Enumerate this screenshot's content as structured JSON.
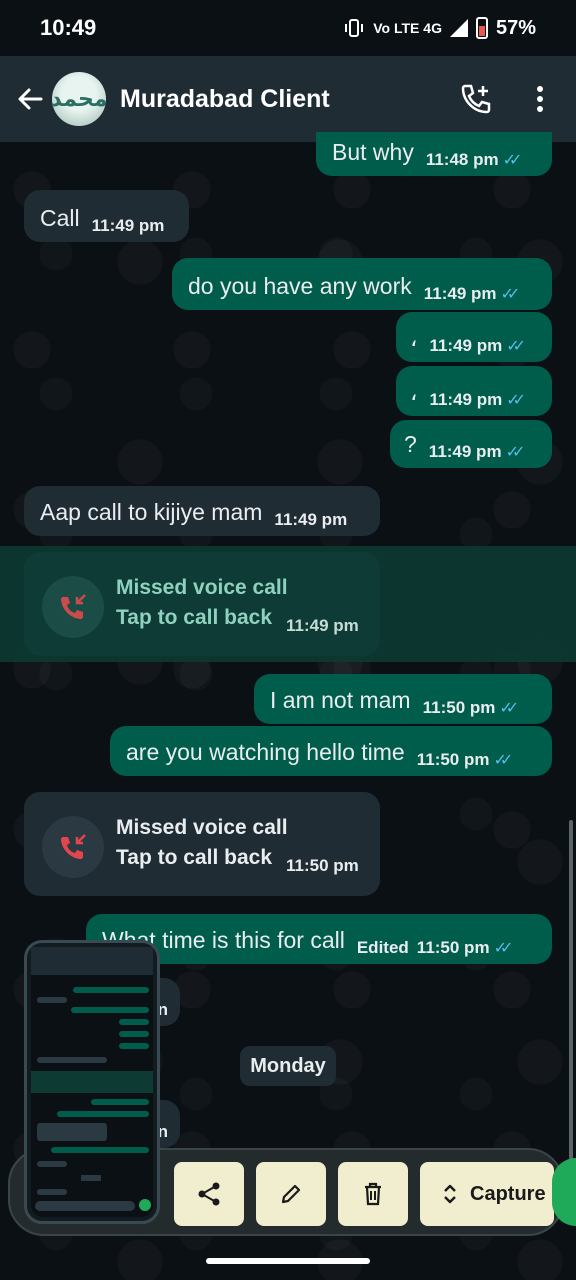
{
  "status_bar": {
    "time": "10:49",
    "network": "Vo LTE 4G",
    "battery": "57%"
  },
  "header": {
    "avatar_text": "محمد",
    "contact_name": "Muradabad Client"
  },
  "messages": [
    {
      "dir": "out",
      "text": "But why",
      "time": "11:48 pm",
      "ticks": "✓✓"
    },
    {
      "dir": "in",
      "text": "Call",
      "time": "11:49 pm"
    },
    {
      "dir": "out",
      "text": "do you have any work",
      "time": "11:49 pm",
      "ticks": "✓✓"
    },
    {
      "dir": "out",
      "text": "،",
      "time": "11:49 pm",
      "ticks": "✓✓"
    },
    {
      "dir": "out",
      "text": "،",
      "time": "11:49 pm",
      "ticks": "✓✓"
    },
    {
      "dir": "out",
      "text": "?",
      "time": "11:49 pm",
      "ticks": "✓✓"
    },
    {
      "dir": "in",
      "text": "Aap call to kijiye mam",
      "time": "11:49 pm"
    },
    {
      "dir": "out",
      "text": "I am not mam",
      "time": "11:50 pm",
      "ticks": "✓✓"
    },
    {
      "dir": "out",
      "text": "are you watching hello time",
      "time": "11:50 pm",
      "ticks": "✓✓"
    },
    {
      "dir": "out",
      "text": "What time is this for call",
      "edited": "Edited",
      "time": "11:50 pm",
      "ticks": "✓✓"
    }
  ],
  "calls": [
    {
      "title": "Missed voice call",
      "subtitle": "Tap to call back",
      "time": "11:49 pm"
    },
    {
      "title": "Missed voice call",
      "subtitle": "Tap to call back",
      "time": "11:50 pm"
    }
  ],
  "partial_times": [
    "n",
    "n"
  ],
  "date_chip": "Monday",
  "toolbar": {
    "capture_label": "Capture"
  },
  "colors": {
    "incoming_bubble": "#1f2c34",
    "outgoing_bubble": "#005c4b",
    "read_ticks": "#53bdeb",
    "missed_call": "#e0464e",
    "toolbar_button": "#f1edcf"
  },
  "icons": [
    "back-arrow-icon",
    "add-call-icon",
    "more-vert-icon",
    "missed-call-icon",
    "share-icon",
    "edit-pencil-icon",
    "delete-icon",
    "expand-icon"
  ]
}
